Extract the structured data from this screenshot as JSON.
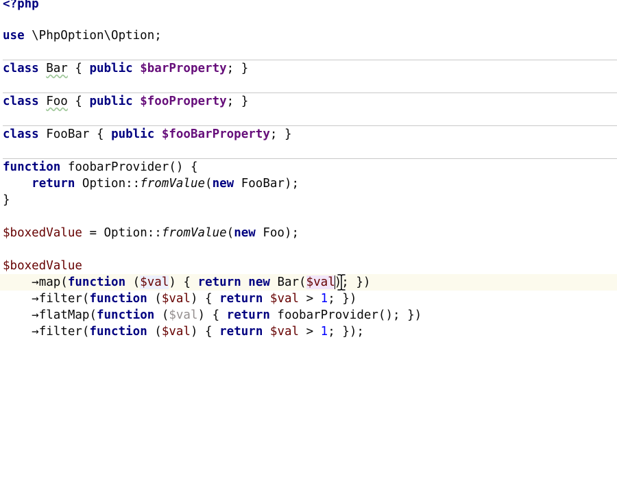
{
  "editor": {
    "language": "php",
    "lines": {
      "l1": {
        "open_tag": "<?php"
      },
      "l3": {
        "use": "use",
        "ns": " \\PhpOption\\Option;"
      },
      "l5": {
        "class_kw": "class",
        "sp1": " ",
        "name": "Bar",
        "brace": " { ",
        "public_kw": "public",
        "sp2": " ",
        "prop": "$barProperty",
        "end": "; }"
      },
      "l7": {
        "class_kw": "class",
        "sp1": " ",
        "name": "Foo",
        "brace": " { ",
        "public_kw": "public",
        "sp2": " ",
        "prop": "$fooProperty",
        "end": "; }"
      },
      "l9": {
        "class_kw": "class",
        "sp1": " ",
        "name": "FooBar",
        "brace": " { ",
        "public_kw": "public",
        "sp2": " ",
        "prop": "$fooBarProperty",
        "end": "; }"
      },
      "l11": {
        "function_kw": "function",
        "rest": " foobarProvider() {"
      },
      "l12": {
        "indent": "    ",
        "return_kw": "return",
        "mid": " Option::",
        "call": "fromValue",
        "open": "(",
        "new_kw": "new",
        "rest": " FooBar);"
      },
      "l13": {
        "close": "}"
      },
      "l15": {
        "var": "$boxedValue",
        "mid": " = Option::",
        "call": "fromValue",
        "open": "(",
        "new_kw": "new",
        "rest": " Foo);"
      },
      "l17": {
        "var": "$boxedValue"
      },
      "l18": {
        "indent": "    ",
        "arrow": "→map(",
        "function_kw": "function",
        "p1": " (",
        "param": "$val",
        "p2": ") { ",
        "return_kw": "return",
        "sp": " ",
        "new_kw": "new",
        "mid": " Bar(",
        "arg": "$val",
        "end": "; })"
      },
      "l19": {
        "indent": "    ",
        "arrow": "→filter(",
        "function_kw": "function",
        "p1": " (",
        "param": "$val",
        "p2": ") { ",
        "return_kw": "return",
        "sp": " ",
        "var": "$val",
        "op": " > ",
        "num": "1",
        "end": "; })"
      },
      "l20": {
        "indent": "    ",
        "arrow": "→flatMap(",
        "function_kw": "function",
        "p1": " (",
        "param": "$val",
        "p2": ") { ",
        "return_kw": "return",
        "rest": " foobarProvider(); })"
      },
      "l21": {
        "indent": "    ",
        "arrow": "→filter(",
        "function_kw": "function",
        "p1": " (",
        "param": "$val",
        "p2": ") { ",
        "return_kw": "return",
        "sp": " ",
        "var": "$val",
        "op": " > ",
        "num": "1",
        "end": "; });"
      }
    },
    "cursor_paren": ")"
  },
  "colors": {
    "keyword": "#000080",
    "variable": "#660000",
    "unused_variable": "#948e8e",
    "property": "#660e7a",
    "number": "#0000ff",
    "current_line": "#fcfaed",
    "separator": "#c8c8c8"
  },
  "icons": [
    "text-cursor-ibeam-icon"
  ]
}
